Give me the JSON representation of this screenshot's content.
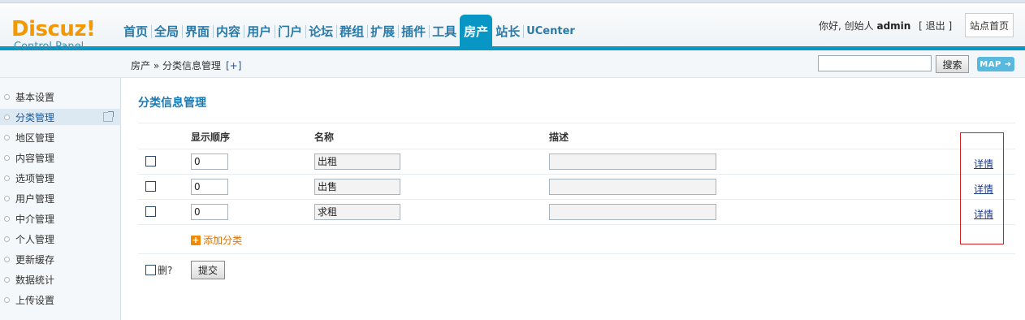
{
  "header": {
    "logo_main": "Discuz!",
    "logo_sub": "Control Panel",
    "nav": [
      "首页",
      "全局",
      "界面",
      "内容",
      "用户",
      "门户",
      "论坛",
      "群组",
      "扩展",
      "插件",
      "工具",
      "房产",
      "站长",
      "UCenter"
    ],
    "active_nav": "房产",
    "greeting": "你好, 创始人",
    "username": "admin",
    "logout": "[ 退出 ]",
    "site_home": "站点首页"
  },
  "breadcrumb": {
    "text": "房产 » 分类信息管理",
    "add": "[+]",
    "search_button": "搜索",
    "map_button": "MAP ➜"
  },
  "sidebar": {
    "items": [
      "基本设置",
      "分类管理",
      "地区管理",
      "内容管理",
      "选项管理",
      "用户管理",
      "中介管理",
      "个人管理",
      "更新缓存",
      "数据统计",
      "上传设置"
    ],
    "active": "分类管理"
  },
  "main": {
    "title": "分类信息管理",
    "columns": [
      "显示顺序",
      "名称",
      "描述"
    ],
    "rows": [
      {
        "order": "0",
        "name": "出租",
        "description": "",
        "link": "详情"
      },
      {
        "order": "0",
        "name": "出售",
        "description": "",
        "link": "详情"
      },
      {
        "order": "0",
        "name": "求租",
        "description": "",
        "link": "详情"
      }
    ],
    "add_category": "添加分类",
    "delete_label": "删?",
    "submit": "提交"
  },
  "colors": {
    "accent": "#0896c4",
    "logo": "#f39800",
    "link": "#1a3a8a",
    "highlight_box": "#cc2222"
  }
}
